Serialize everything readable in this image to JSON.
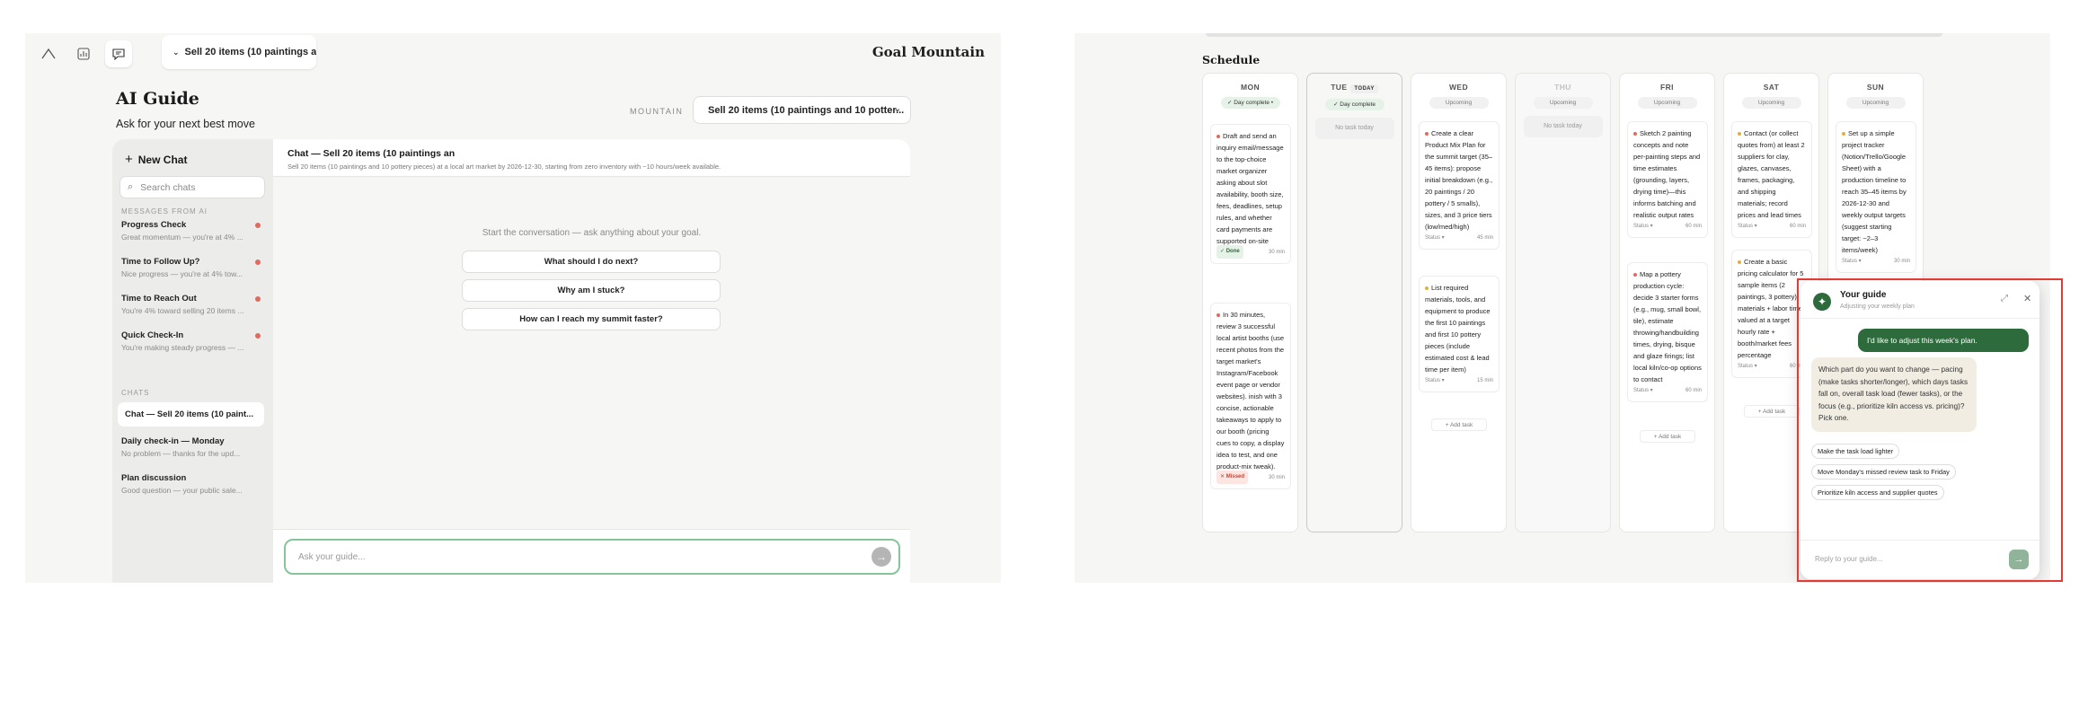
{
  "left": {
    "brand": "Goal Mountain",
    "goal_pill": "Sell 20 items (10 paintings an...",
    "title": "AI Guide",
    "subtitle": "Ask for your next best move",
    "mountain_label": "MOUNTAIN",
    "mountain_value": "Sell 20 items (10 paintings and 10 potter...",
    "new_chat": "New Chat",
    "search_placeholder": "Search chats",
    "messages_label": "MESSAGES FROM AI",
    "messages": [
      {
        "title": "Progress Check",
        "preview": "Great momentum — you're at 4% ..."
      },
      {
        "title": "Time to Follow Up?",
        "preview": "Nice progress — you're at 4% tow..."
      },
      {
        "title": "Time to Reach Out",
        "preview": "You're 4% toward selling 20 items ..."
      },
      {
        "title": "Quick Check-In",
        "preview": "You're making steady progress — ..."
      }
    ],
    "chats_label": "CHATS",
    "chats": [
      {
        "title": "Chat — Sell 20 items (10 paint...",
        "preview": ""
      },
      {
        "title": "Daily check-in — Monday",
        "preview": "No problem — thanks for the upd..."
      },
      {
        "title": "Plan discussion",
        "preview": "Good question — your public sale..."
      }
    ],
    "chat_title": "Chat — Sell 20 items (10 paintings an",
    "chat_subtitle": "Sell 20 items (10 paintings and 10 pottery pieces) at a local art market by 2026-12-30, starting from zero inventory with ~10 hours/week available.",
    "starter": "Start the conversation — ask anything about your goal.",
    "suggestions": [
      "What should I do next?",
      "Why am I stuck?",
      "How can I reach my summit faster?"
    ],
    "input_placeholder": "Ask your guide..."
  },
  "right": {
    "schedule_title": "Schedule",
    "days": {
      "mon": {
        "name": "MON",
        "badge": "✓ Day complete •"
      },
      "tue": {
        "name": "TUE",
        "today": "TODAY",
        "badge": "✓ Day complete",
        "notask": "No task today"
      },
      "wed": {
        "name": "WED",
        "badge": "Upcoming"
      },
      "thu": {
        "name": "THU",
        "badge": "Upcoming",
        "notask": "No task today"
      },
      "fri": {
        "name": "FRI",
        "badge": "Upcoming"
      },
      "sat": {
        "name": "SAT",
        "badge": "Upcoming"
      },
      "sun": {
        "name": "SUN",
        "badge": "Upcoming"
      }
    },
    "tasks": {
      "mon1": {
        "text": "Draft and send an inquiry email/message to the top-choice market organizer asking about slot availability, booth size, fees, deadlines, setup rules, and whether card payments are supported on-site",
        "status": "✓ Done",
        "dur": "30 min"
      },
      "mon2": {
        "text": "In 30 minutes, review 3 successful local artist booths (use recent photos from the target market's Instagram/Facebook event page or vendor websites). inish with 3 concise, actionable takeaways to apply to our booth (pricing cues to copy, a display idea to test, and one product-mix tweak).",
        "status": "✕ Missed",
        "dur": "30 min"
      },
      "wed1": {
        "text": "Create a clear Product Mix Plan for the summit target (35–45 items): propose initial breakdown (e.g., 20 paintings / 20 pottery / 5 smalls), sizes, and 3 price tiers (low/med/high)",
        "status": "Status ▾",
        "dur": "45 min"
      },
      "wed2": {
        "text": "List required materials, tools, and equipment to produce the first 10 paintings and first 10 pottery pieces (include estimated cost & lead time per item)",
        "status": "Status ▾",
        "dur": "15 min"
      },
      "fri1": {
        "text": "Sketch 2 painting concepts and note per-painting steps and time estimates (grounding, layers, drying time)—this informs batching and realistic output rates",
        "status": "Status ▾",
        "dur": "60 min"
      },
      "fri2": {
        "text": "Map a pottery production cycle: decide 3 starter forms (e.g., mug, small bowl, tile), estimate throwing/handbuilding times, drying, bisque and glaze firings; list local kiln/co-op options to contact",
        "status": "Status ▾",
        "dur": "60 min"
      },
      "sat1": {
        "text": "Contact (or collect quotes from) at least 2 suppliers for clay, glazes, canvases, frames, packaging, and shipping materials; record prices and lead times",
        "status": "Status ▾",
        "dur": "60 min"
      },
      "sat2": {
        "text": "Create a basic pricing calculator for 5 sample items (2 paintings, 3 pottery): materials + labor time valued at a target hourly rate + booth/market fees percentage",
        "status": "Status ▾",
        "dur": "60 min"
      },
      "sun1": {
        "text": "Set up a simple project tracker (Notion/Trello/Google Sheet) with a production timeline to reach 35–45 items by 2026-12-30 and weekly output targets (suggest starting target: ~2–3 items/week)",
        "status": "Status ▾",
        "dur": "30 min"
      }
    },
    "add_task": "+ Add task",
    "guide": {
      "title": "Your guide",
      "subtitle": "Adjusting your weekly plan",
      "user_msg": "I'd like to adjust this week's plan.",
      "bot_msg": "Which part do you want to change — pacing (make tasks shorter/longer), which days tasks fall on, overall task load (fewer tasks), or the focus (e.g., prioritize kiln access vs. pricing)? Pick one.",
      "chips": [
        "Make the task load lighter",
        "Move Monday's missed review task to Friday",
        "Prioritize kiln access and supplier quotes"
      ],
      "reply_placeholder": "Reply to your guide..."
    }
  },
  "colors": {
    "accent": "#2e6b3c",
    "alert": "#e06a5d",
    "highlight": "#e53935"
  }
}
